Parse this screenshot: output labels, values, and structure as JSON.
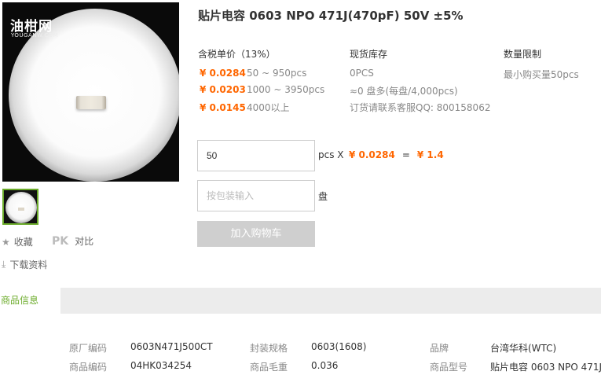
{
  "product": {
    "title": "贴片电容 0603 NPO 471J(470pF) 50V ±5%",
    "image_watermark": "油柑网",
    "image_watermark_sub": "YOUGANW.COM"
  },
  "actions": {
    "favorite": "收藏",
    "pk": "PK",
    "compare": "对比",
    "download": "下载资料"
  },
  "pricing": {
    "header": "含税单价（13%）",
    "tiers": [
      {
        "price": "¥ 0.0284",
        "range": "50 ~ 950pcs"
      },
      {
        "price": "¥ 0.0203",
        "range": "1000 ~ 3950pcs"
      },
      {
        "price": "¥ 0.0145",
        "range": "4000以上"
      }
    ]
  },
  "stock": {
    "header": "现货库存",
    "lines": [
      "0PCS",
      "≈0 盘多(每盘/4,000pcs)",
      "订货请联系客服QQ: 800158062"
    ]
  },
  "limit": {
    "header": "数量限制",
    "text": "最小购买量50pcs"
  },
  "order": {
    "quantity_value": "50",
    "unit_label": "pcs X",
    "unit_price": "¥ 0.0284",
    "equals": "=",
    "total": "¥ 1.4",
    "pack_placeholder": "按包装输入",
    "pack_unit": "盘",
    "add_to_cart": "加入购物车"
  },
  "tabs": {
    "info": "商品信息"
  },
  "specs": [
    {
      "label": "原厂编码",
      "value": "0603N471J500CT"
    },
    {
      "label": "封装规格",
      "value": "0603(1608)"
    },
    {
      "label": "品牌",
      "value": "台湾华科(WTC)"
    },
    {
      "label": "商品编码",
      "value": "04HK034254"
    },
    {
      "label": "商品毛重",
      "value": "0.036"
    },
    {
      "label": "商品型号",
      "value": "贴片电容 0603 NPO 471J."
    }
  ],
  "colors": {
    "accent_orange": "#ff6600",
    "accent_green": "#6bab2a",
    "button_disabled": "#cfcfcf"
  }
}
